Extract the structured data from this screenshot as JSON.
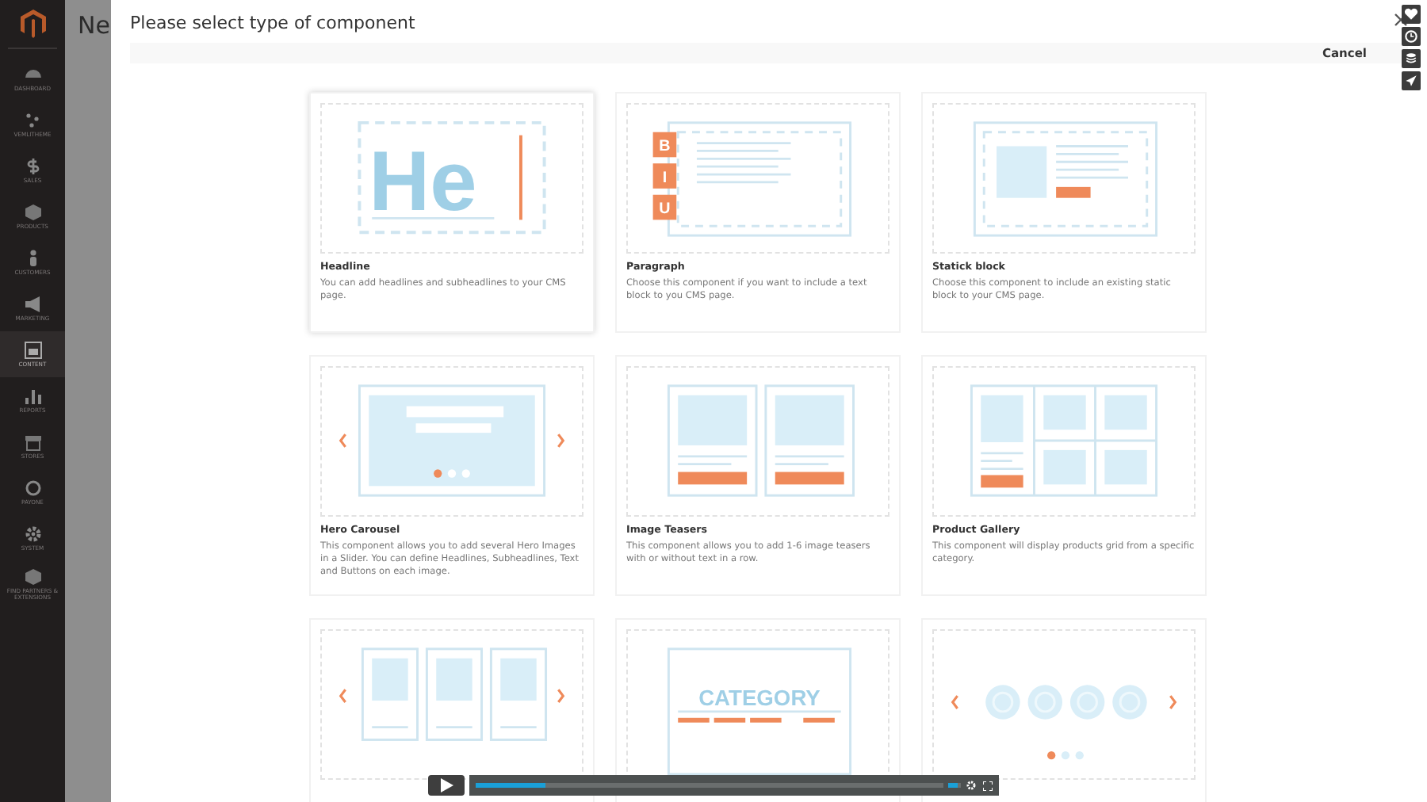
{
  "sidebar": {
    "items": [
      {
        "label": "DASHBOARD",
        "selected": false
      },
      {
        "label": "VEMLITHEME",
        "selected": false
      },
      {
        "label": "SALES",
        "selected": false
      },
      {
        "label": "PRODUCTS",
        "selected": false
      },
      {
        "label": "CUSTOMERS",
        "selected": false
      },
      {
        "label": "MARKETING",
        "selected": false
      },
      {
        "label": "CONTENT",
        "selected": true
      },
      {
        "label": "REPORTS",
        "selected": false
      },
      {
        "label": "STORES",
        "selected": false
      },
      {
        "label": "PAYONE",
        "selected": false
      },
      {
        "label": "SYSTEM",
        "selected": false
      },
      {
        "label": "FIND PARTNERS & EXTENSIONS",
        "selected": false
      }
    ]
  },
  "page": {
    "title": "Ne"
  },
  "modal": {
    "title": "Please select type of component",
    "cancel": "Cancel"
  },
  "components": [
    {
      "kind": "headline",
      "title": "Headline",
      "description": "You can add headlines and subheadlines to your CMS page.",
      "selected": true,
      "art_text": "He"
    },
    {
      "kind": "paragraph",
      "title": "Paragraph",
      "description": "Choose this component if you want to include a text block to you CMS page.",
      "selected": false,
      "art_letters": [
        "B",
        "I",
        "U"
      ]
    },
    {
      "kind": "static",
      "title": "Statick block",
      "description": "Choose this component to include an existing static block to your CMS page.",
      "selected": false
    },
    {
      "kind": "carousel",
      "title": "Hero Carousel",
      "description": "This component allows you to add several Hero Images in a Slider. You can define Headlines, Subheadlines, Text and Buttons on each image.",
      "selected": false
    },
    {
      "kind": "teasers",
      "title": "Image Teasers",
      "description": "This component allows you to add 1-6 image teasers with or without text in a row.",
      "selected": false
    },
    {
      "kind": "gallery",
      "title": "Product Gallery",
      "description": "This component will display products grid from a specific category.",
      "selected": false
    },
    {
      "kind": "cards",
      "selected": false
    },
    {
      "kind": "category",
      "selected": false,
      "art_text": "CATEGORY"
    },
    {
      "kind": "circles",
      "selected": false
    }
  ],
  "video_player": {
    "progress": {
      "level": 0.15
    },
    "volume": {
      "level": 0.8
    }
  }
}
